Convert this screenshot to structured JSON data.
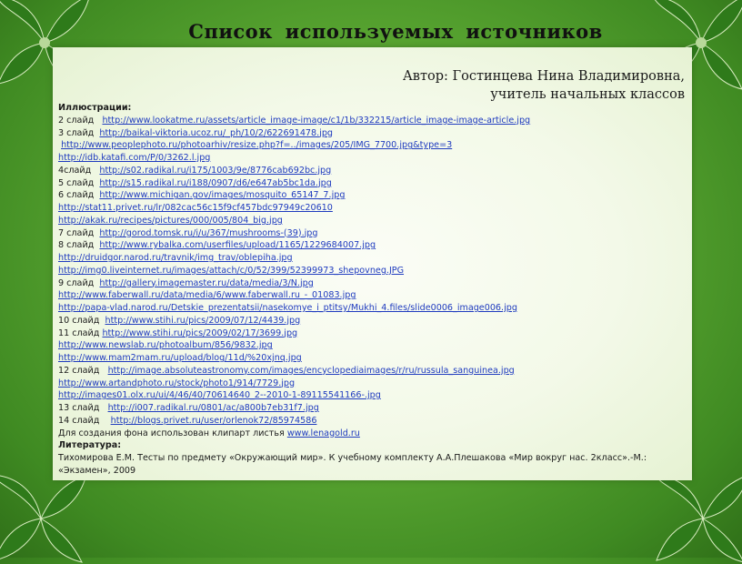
{
  "title": "Список используемых источников",
  "author": {
    "line1": "Автор: Гостинцева Нина Владимировна,",
    "line2": "учитель начальных классов"
  },
  "illustrations_heading": "Иллюстрации:",
  "sources": [
    {
      "prefix": "2 слайд   ",
      "url": "http://www.lookatme.ru/assets/article_image-image/c1/1b/332215/article_image-image-article.jpg"
    },
    {
      "prefix": "3 слайд  ",
      "url": "http://baikal-viktoria.ucoz.ru/_ph/10/2/622691478.jpg"
    },
    {
      "prefix": " ",
      "url": "http://www.peoplephoto.ru/photoarhiv/resize.php?f=../images/205/IMG_7700.jpg&type=3"
    },
    {
      "prefix": "",
      "url": "http://idb.katafi.com/P/0/3262.l.jpg"
    },
    {
      "prefix": "4слайд   ",
      "url": "http://s02.radikal.ru/i175/1003/9e/8776cab692bc.jpg"
    },
    {
      "prefix": "5 слайд  ",
      "url": "http://s15.radikal.ru/i188/0907/d6/e647ab5bc1da.jpg"
    },
    {
      "prefix": "6 слайд  ",
      "url": "http://www.michigan.gov/images/mosquito_65147_7.jpg"
    },
    {
      "prefix": "",
      "url": "http://stat11.privet.ru/lr/082cac56c15f9cf457bdc97949c20610"
    },
    {
      "prefix": "",
      "url": "http://akak.ru/recipes/pictures/000/005/804_big.jpg"
    },
    {
      "prefix": "7 слайд  ",
      "url": "http://gorod.tomsk.ru/i/u/367/mushrooms-(39).jpg"
    },
    {
      "prefix": "8 слайд  ",
      "url": "http://www.rybalka.com/userfiles/upload/1165/1229684007.jpg"
    },
    {
      "prefix": "",
      "url": "http://druidgor.narod.ru/travnik/img_trav/oblepiha.jpg"
    },
    {
      "prefix": "",
      "url": "http://img0.liveinternet.ru/images/attach/c/0/52/399/52399973_shepovneg.JPG"
    },
    {
      "prefix": "9 слайд  ",
      "url": "http://gallery.imagemaster.ru/data/media/3/N.jpg"
    },
    {
      "prefix": "",
      "url": "http://www.faberwall.ru/data/media/6/www.faberwall.ru_-_01083.jpg"
    },
    {
      "prefix": "",
      "url": "http://papa-vlad.narod.ru/Detskie_prezentatsii/nasekomye_i_ptitsy/Mukhi_4.files/slide0006_image006.jpg"
    },
    {
      "prefix": "10 слайд  ",
      "url": "http://www.stihi.ru/pics/2009/07/12/4439.jpg"
    },
    {
      "prefix": "11 слайд ",
      "url": "http://www.stihi.ru/pics/2009/02/17/3699.jpg"
    },
    {
      "prefix": "",
      "url": "http://www.newslab.ru/photoalbum/856/9832.jpg"
    },
    {
      "prefix": "",
      "url": "http://www.mam2mam.ru/upload/blog/11d/%20xjnq.jpg"
    },
    {
      "prefix": "12 слайд   ",
      "url": "http://image.absoluteastronomy.com/images/encyclopediaimages/r/ru/russula_sanguinea.jpg"
    },
    {
      "prefix": "",
      "url": "http://www.artandphoto.ru/stock/photo1/914/7729.jpg"
    },
    {
      "prefix": "",
      "url": "http://images01.olx.ru/ui/4/46/40/70614640_2--2010-1-89115541166-.jpg"
    },
    {
      "prefix": "13 слайд   ",
      "url": "http://i007.radikal.ru/0801/ac/a800b7eb31f7.jpg"
    },
    {
      "prefix": "14 слайд    ",
      "url": "http://blogs.privet.ru/user/orlenok72/85974586"
    }
  ],
  "clipart": {
    "text": "Для создания фона использован клипарт листья  ",
    "url": "www.lenagold.ru"
  },
  "literature_heading": "Литература:",
  "literature_text": "Тихомирова Е.М. Тесты по  предмету «Окружающий мир». К учебному комплекту  А.А.Плешакова «Мир вокруг нас. 2класс».-М.: «Экзамен», 2009"
}
